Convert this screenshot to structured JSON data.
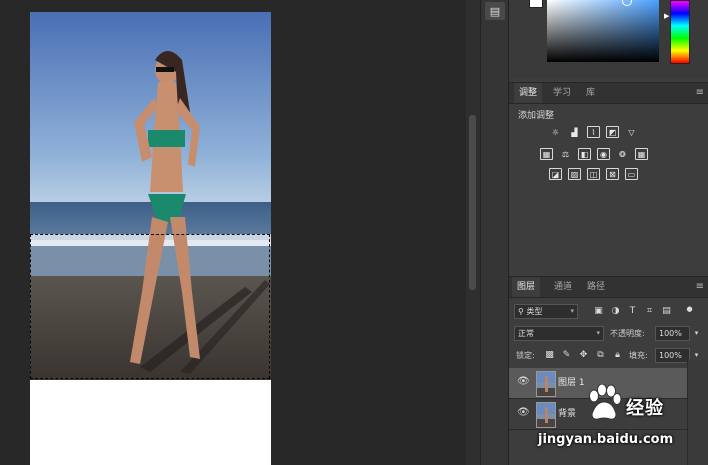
{
  "panels": {
    "adjustments_tabs": [
      "调整",
      "学习",
      "库"
    ],
    "adjustments_title": "添加调整",
    "layers_tabs": [
      "图层",
      "通道",
      "路径"
    ],
    "filter_kind": "类型",
    "blend_mode": "正常",
    "opacity_label": "不透明度:",
    "opacity_value": "100%",
    "lock_label": "锁定:",
    "fill_label": "填充:",
    "fill_value": "100%",
    "layers": [
      {
        "name": "图层 1",
        "selected": true
      },
      {
        "name": "背景",
        "selected": false
      }
    ],
    "menu_glyph": "≡"
  },
  "watermark": {
    "brand": "经验",
    "url": "jingyan.baidu.com"
  },
  "colors": {
    "accent_selected_layer": "#5a5a5a",
    "panel_bg": "#3d3d3d",
    "workspace_bg": "#282828"
  },
  "icons": {
    "adjust_row1": [
      "brightness-icon",
      "levels-icon",
      "curves-icon",
      "exposure-icon",
      "vibrance-icon"
    ],
    "adjust_row2": [
      "hue-sat-icon",
      "color-balance-icon",
      "bw-icon",
      "photo-filter-icon",
      "channel-mixer-icon",
      "color-lookup-icon"
    ],
    "adjust_row3": [
      "invert-icon",
      "posterize-icon",
      "threshold-icon",
      "selective-color-icon",
      "gradient-map-icon"
    ]
  }
}
